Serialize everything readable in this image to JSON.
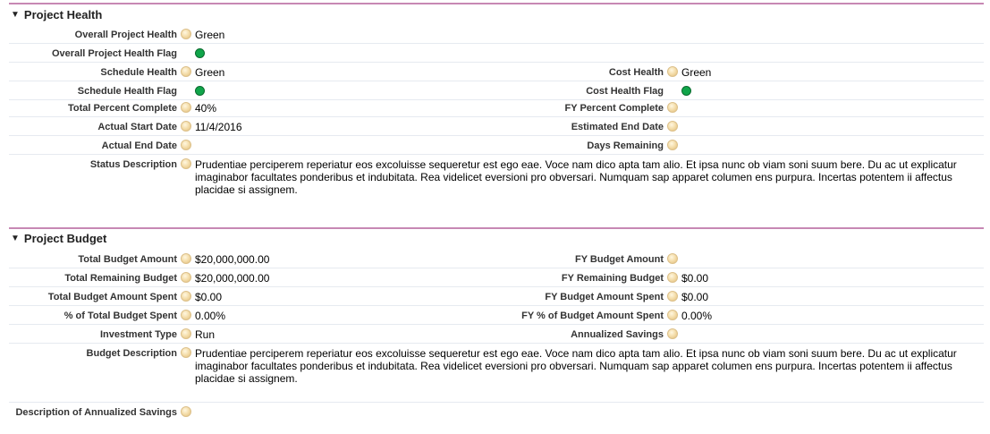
{
  "health": {
    "title": "Project Health",
    "overall_health_label": "Overall Project Health",
    "overall_health_value": "Green",
    "overall_flag_label": "Overall Project Health Flag",
    "schedule_health_label": "Schedule Health",
    "schedule_health_value": "Green",
    "cost_health_label": "Cost Health",
    "cost_health_value": "Green",
    "schedule_flag_label": "Schedule Health Flag",
    "cost_flag_label": "Cost Health Flag",
    "total_pct_label": "Total Percent Complete",
    "total_pct_value": "40%",
    "fy_pct_label": "FY Percent Complete",
    "actual_start_label": "Actual Start Date",
    "actual_start_value": "11/4/2016",
    "est_end_label": "Estimated End Date",
    "actual_end_label": "Actual End Date",
    "days_remaining_label": "Days Remaining",
    "status_desc_label": "Status Description",
    "status_desc_value": "Prudentiae perciperem reperiatur eos excoluisse sequeretur est ego eae. Voce nam dico apta tam alio. Et ipsa nunc ob viam soni suum bere. Du ac ut explicatur imaginabor facultates ponderibus et indubitata. Rea videlicet eversioni pro obversari. Numquam sap apparet columen ens purpura. Incertas potentem ii affectus placidae si assignem."
  },
  "budget": {
    "title": "Project Budget",
    "total_budget_label": "Total Budget Amount",
    "total_budget_value": "$20,000,000.00",
    "fy_budget_label": "FY Budget Amount",
    "total_remaining_label": "Total Remaining Budget",
    "total_remaining_value": "$20,000,000.00",
    "fy_remaining_label": "FY Remaining Budget",
    "fy_remaining_value": "$0.00",
    "total_spent_label": "Total Budget Amount Spent",
    "total_spent_value": "$0.00",
    "fy_spent_label": "FY Budget Amount Spent",
    "fy_spent_value": "$0.00",
    "pct_spent_label": "% of Total Budget Spent",
    "pct_spent_value": "0.00%",
    "fy_pct_spent_label": "FY % of Budget Amount Spent",
    "fy_pct_spent_value": "0.00%",
    "investment_type_label": "Investment Type",
    "investment_type_value": "Run",
    "annualized_savings_label": "Annualized Savings",
    "budget_desc_label": "Budget Description",
    "budget_desc_value": "Prudentiae perciperem reperiatur eos excoluisse sequeretur est ego eae. Voce nam dico apta tam alio. Et ipsa nunc ob viam soni suum bere. Du ac ut explicatur imaginabor facultates ponderibus et indubitata. Rea videlicet eversioni pro obversari. Numquam sap apparet columen ens purpura. Incertas potentem ii affectus placidae si assignem.",
    "annualized_savings_desc_label": "Description of Annualized Savings"
  },
  "colors": {
    "section_rule": "#c788b4",
    "flag_green": "#10a54a",
    "help_icon": "#f5dfae",
    "row_divider": "#e6eaf0"
  },
  "icons": {
    "twisty": "triangle-down-icon",
    "help": "help-bubble-icon",
    "flag": "green-status-flag-icon"
  }
}
